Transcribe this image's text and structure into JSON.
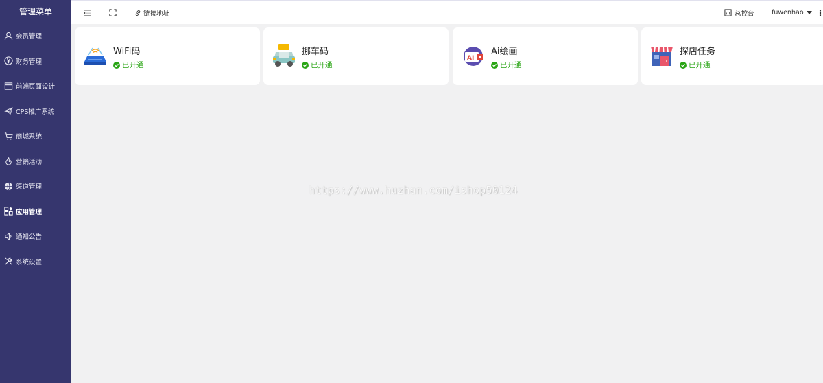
{
  "sidebar": {
    "title": "管理菜单",
    "items": [
      {
        "label": "会员管理",
        "icon": "user-icon"
      },
      {
        "label": "财务管理",
        "icon": "yen-icon"
      },
      {
        "label": "前端页面设计",
        "icon": "layout-icon"
      },
      {
        "label": "CPS推广系统",
        "icon": "send-icon"
      },
      {
        "label": "商城系统",
        "icon": "cart-icon"
      },
      {
        "label": "营销活动",
        "icon": "fire-icon"
      },
      {
        "label": "渠道管理",
        "icon": "globe-icon"
      },
      {
        "label": "应用管理",
        "icon": "apps-icon",
        "active": true
      },
      {
        "label": "通知公告",
        "icon": "speaker-icon"
      },
      {
        "label": "系统设置",
        "icon": "tools-icon"
      }
    ]
  },
  "header": {
    "link_label": "链接地址",
    "console_label": "总控台",
    "username": "fuwenhao",
    "more_label": "⋮"
  },
  "apps": [
    {
      "name": "WiFi码",
      "status": "已开通",
      "icon": "wifi-router-icon"
    },
    {
      "name": "挪车码",
      "status": "已开通",
      "icon": "car-icon"
    },
    {
      "name": "Ai绘画",
      "status": "已开通",
      "icon": "ai-painting-icon"
    },
    {
      "name": "探店任务",
      "status": "已开通",
      "icon": "shop-icon"
    }
  ],
  "watermark": "https://www.huzhan.com/ishop50124",
  "colors": {
    "sidebar_bg": "#36366e",
    "status_green": "#2aa515",
    "page_bg": "#f1f1f2"
  }
}
